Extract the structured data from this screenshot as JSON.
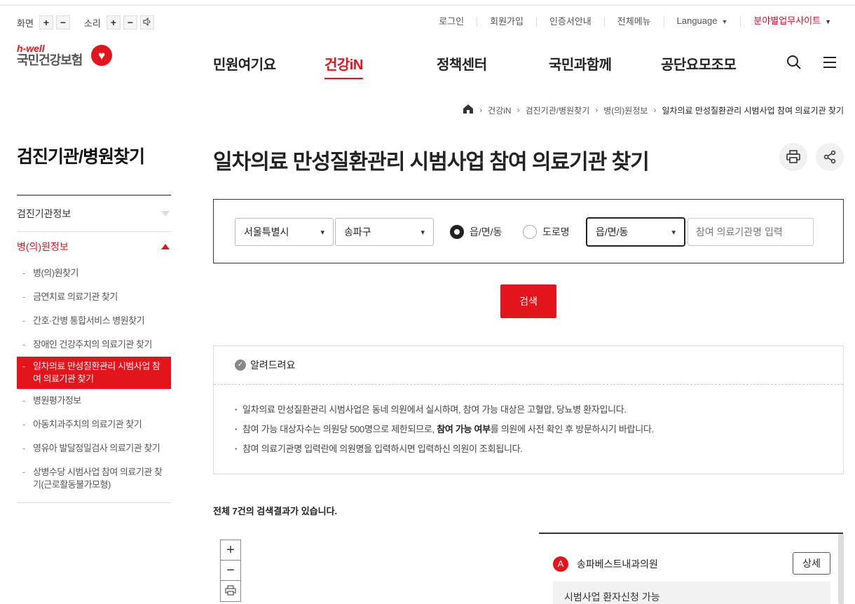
{
  "utility": {
    "screen_label": "화면",
    "sound_label": "소리",
    "plus": "+",
    "minus": "−",
    "links": [
      "로그인",
      "회원가입",
      "인증서안내",
      "전체메뉴"
    ],
    "language": "Language",
    "site": "분야별업무사이트"
  },
  "logo": {
    "hwell": "h-well",
    "name": "국민건강보험"
  },
  "gnb": {
    "items": [
      "민원여기요",
      "건강iN",
      "정책센터",
      "국민과함께",
      "공단요모조모"
    ],
    "active": "건강iN"
  },
  "breadcrumb": [
    "건강iN",
    "검진기관/병원찾기",
    "병(의)원정보",
    "일차의료 만성질환관리 시범사업 참여 의료기관 찾기"
  ],
  "lnb": {
    "title": "검진기관/병원찾기",
    "groups": [
      {
        "label": "검진기관정보"
      },
      {
        "label": "병(의)원정보",
        "items": [
          "병(의)원찾기",
          "금연치료 의료기관 찾기",
          "간호·간병 통합서비스 병원찾기",
          "장애인 건강주치의 의료기관 찾기",
          "일차의료 만성질환관리 시범사업 참여 의료기관 찾기",
          "병원평가정보",
          "아동치과주치의 의료기관 찾기",
          "영유아 발달정밀검사 의료기관 찾기",
          "상병수당 시범사업 참여 의료기관 찾기(근로활동불가모형)"
        ]
      }
    ]
  },
  "page_title": "일차의료 만성질환관리 시범사업 참여 의료기관 찾기",
  "search": {
    "sido": "서울특별시",
    "sigungu": "송파구",
    "radio_1": "읍/면/동",
    "radio_2": "도로명",
    "dong_select": "읍/면/동",
    "name_placeholder": "참여 의료기관명 입력",
    "button": "검색"
  },
  "notice": {
    "title": "알려드려요",
    "line1": "일차의료 만성질환관리 시범사업은 동네 의원에서 실시하며, 참여 가능 대상은 고혈압, 당뇨병 환자입니다.",
    "line2_a": "참여 가능 대상자수는 의원당 500명으로 제한되므로, ",
    "line2_b": "참여 가능 여부",
    "line2_c": "를 의원에 사전 확인 후 방문하시기 바랍니다.",
    "line3": "참여 의료기관명 입력란에 의원명을 입력하시면 입력하신 의원이 조회됩니다."
  },
  "result_count": "전체 7건의 검색결과가 있습니다.",
  "map_controls": {
    "zoom_in": "+",
    "zoom_out": "−"
  },
  "results": [
    {
      "badge": "A",
      "name": "송파베스트내과의원",
      "detail_button": "상세",
      "status": "시범사업 환자신청 가능"
    }
  ],
  "colors": {
    "brand_red": "#e3141b",
    "text": "#222222"
  }
}
